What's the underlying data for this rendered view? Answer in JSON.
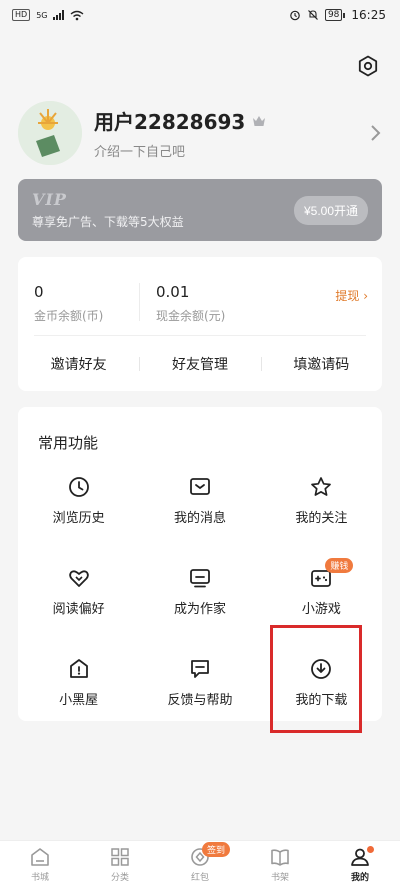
{
  "status_bar": {
    "hd_label": "HD",
    "network_label": "5G",
    "battery": "98",
    "time": "16:25"
  },
  "profile": {
    "username": "用户22828693",
    "bio": "介绍一下自己吧"
  },
  "vip": {
    "title": "VIP",
    "description": "尊享免广告、下载等5大权益",
    "button": "¥5.00开通"
  },
  "wallet": {
    "coins_amount": "0",
    "coins_label": "金币余额(币)",
    "cash_amount": "0.01",
    "cash_label": "现金余额(元)",
    "withdraw_label": "提现 ›",
    "actions": [
      "邀请好友",
      "好友管理",
      "填邀请码"
    ]
  },
  "functions": {
    "title": "常用功能",
    "items": [
      {
        "label": "浏览历史",
        "icon": "clock-icon"
      },
      {
        "label": "我的消息",
        "icon": "message-icon"
      },
      {
        "label": "我的关注",
        "icon": "star-icon"
      },
      {
        "label": "阅读偏好",
        "icon": "heart-icon"
      },
      {
        "label": "成为作家",
        "icon": "writer-icon"
      },
      {
        "label": "小游戏",
        "icon": "gamepad-icon",
        "badge": "赚钱"
      },
      {
        "label": "小黑屋",
        "icon": "blackhouse-icon"
      },
      {
        "label": "反馈与帮助",
        "icon": "feedback-icon"
      },
      {
        "label": "我的下载",
        "icon": "download-icon"
      }
    ]
  },
  "tabs": [
    {
      "label": "书城",
      "icon": "home-icon"
    },
    {
      "label": "分类",
      "icon": "grid-icon"
    },
    {
      "label": "红包",
      "icon": "red-packet-icon",
      "badge": "签到"
    },
    {
      "label": "书架",
      "icon": "book-icon"
    },
    {
      "label": "我的",
      "icon": "user-icon",
      "active": true
    }
  ],
  "colors": {
    "accent": "#e07a2a",
    "badge": "#f07a3e",
    "highlight": "#d92a2a",
    "vip_bg": "#9a9ba0"
  }
}
